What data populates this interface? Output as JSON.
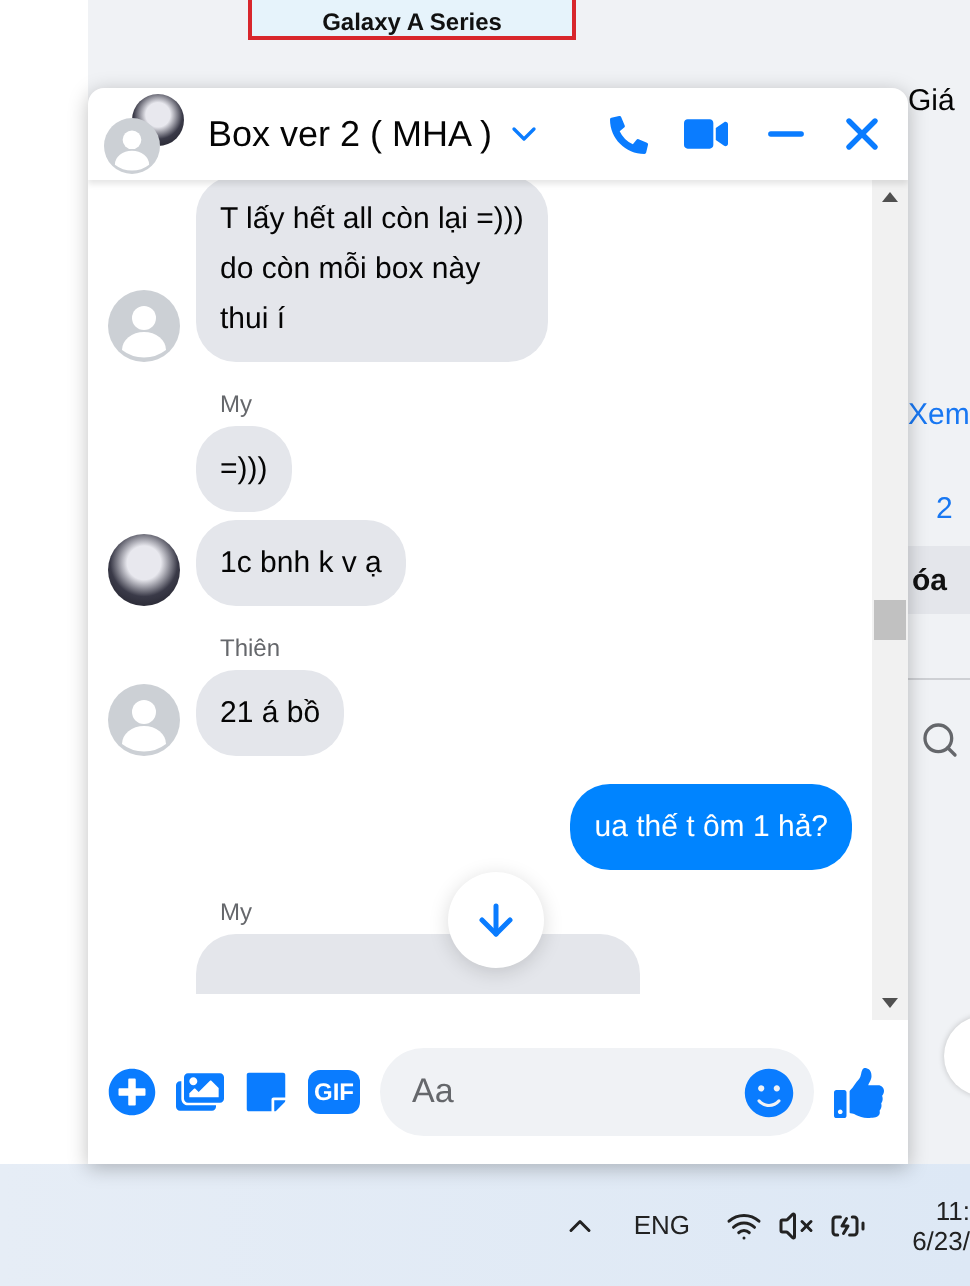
{
  "background_page": {
    "ad_caption": "Galaxy A Series",
    "side_texts": [
      {
        "text": "Giá",
        "kind": "heading"
      },
      {
        "text": "Xem",
        "kind": "link"
      },
      {
        "text": "2",
        "kind": "link"
      },
      {
        "text": "óa",
        "kind": "bar"
      }
    ]
  },
  "chat": {
    "title": "Box ver 2 ( MHA )",
    "groups": [
      {
        "kind": "incoming",
        "avatar": {
          "kind": "default"
        },
        "bubbles": [
          "T lấy hết all còn lại =)))\ndo còn mỗi box này\nthui í"
        ]
      },
      {
        "kind": "incoming",
        "sender": "My",
        "avatar": {
          "kind": "photo"
        },
        "bubbles": [
          "=)))",
          "1c bnh k v ạ"
        ]
      },
      {
        "kind": "incoming",
        "sender": "Thiên",
        "avatar": {
          "kind": "default"
        },
        "bubbles": [
          "21 á bồ"
        ]
      },
      {
        "kind": "outgoing",
        "bubbles": [
          "ua thế t ôm 1 hả?"
        ]
      },
      {
        "kind": "incoming",
        "sender": "My",
        "cut_bubble": true
      }
    ],
    "composer": {
      "gif_label": "GIF",
      "placeholder": "Aa"
    }
  },
  "taskbar": {
    "language": "ENG",
    "time": "11:",
    "date": "6/23/"
  }
}
